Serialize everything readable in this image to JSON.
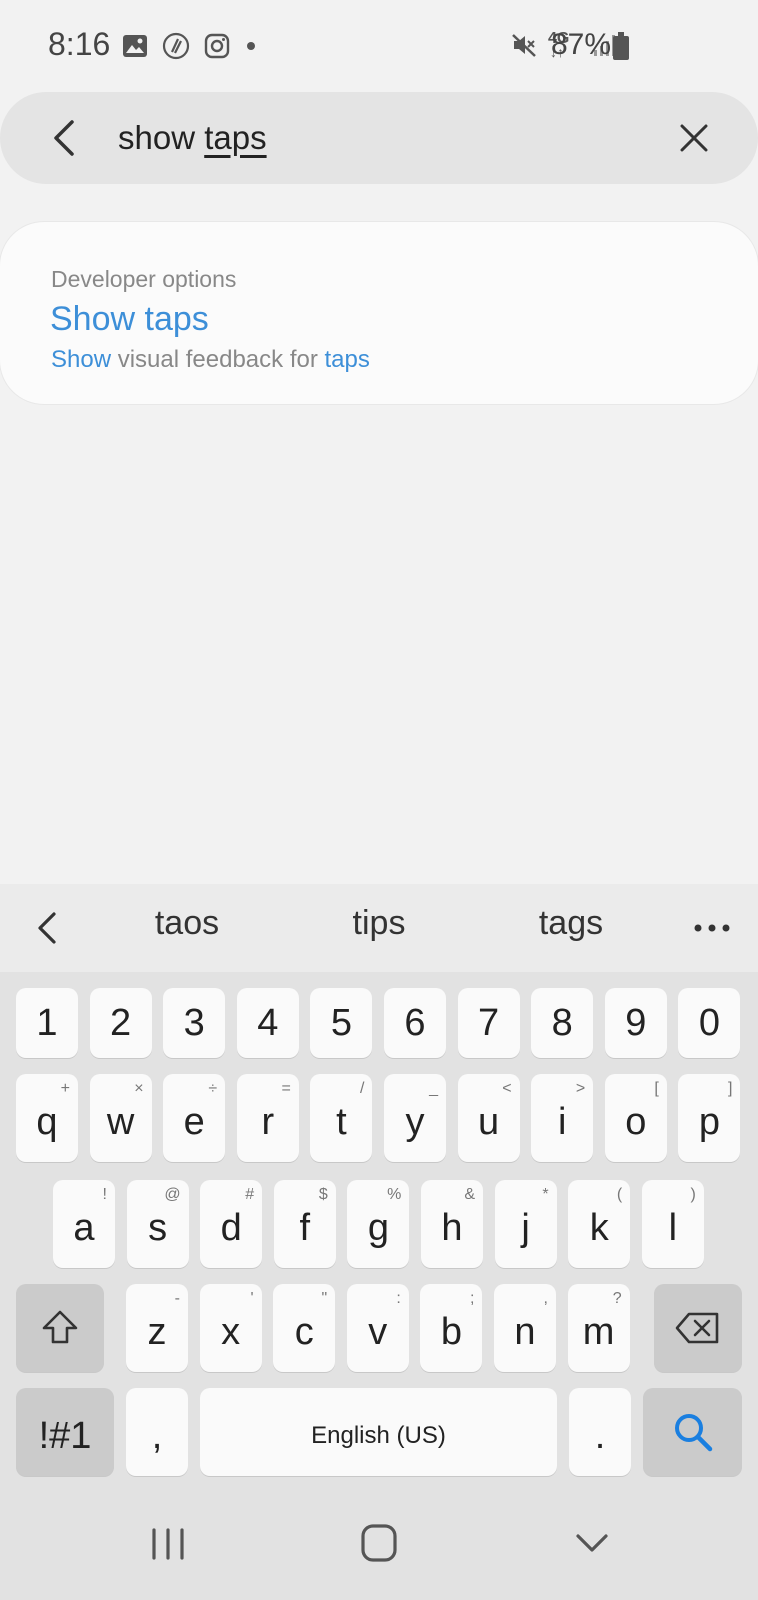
{
  "status_bar": {
    "time": "8:16",
    "network": "4G",
    "battery": "87%",
    "icons_left": [
      "gallery-icon",
      "vsco-icon",
      "instagram-icon",
      "notification-dot-icon"
    ],
    "icons_right": [
      "mute-icon",
      "lte-icon",
      "signal-icon",
      "battery-icon"
    ]
  },
  "search": {
    "query_prefix": "show ",
    "query_underlined": "taps"
  },
  "result": {
    "category": "Developer options",
    "title": "Show taps",
    "desc_1": "Show",
    "desc_2": " visual feedback for ",
    "desc_3": "taps"
  },
  "keyboard": {
    "suggestions": [
      "taos",
      "tips",
      "tags"
    ],
    "number_row": [
      "1",
      "2",
      "3",
      "4",
      "5",
      "6",
      "7",
      "8",
      "9",
      "0"
    ],
    "row1": [
      {
        "k": "q",
        "h": "+"
      },
      {
        "k": "w",
        "h": "×"
      },
      {
        "k": "e",
        "h": "÷"
      },
      {
        "k": "r",
        "h": "="
      },
      {
        "k": "t",
        "h": "/"
      },
      {
        "k": "y",
        "h": "_"
      },
      {
        "k": "u",
        "h": "<"
      },
      {
        "k": "i",
        "h": ">"
      },
      {
        "k": "o",
        "h": "["
      },
      {
        "k": "p",
        "h": "]"
      }
    ],
    "row2": [
      {
        "k": "a",
        "h": "!"
      },
      {
        "k": "s",
        "h": "@"
      },
      {
        "k": "d",
        "h": "#"
      },
      {
        "k": "f",
        "h": "$"
      },
      {
        "k": "g",
        "h": "%"
      },
      {
        "k": "h",
        "h": "&"
      },
      {
        "k": "j",
        "h": "*"
      },
      {
        "k": "k",
        "h": "("
      },
      {
        "k": "l",
        "h": ")"
      }
    ],
    "row3": [
      {
        "k": "z",
        "h": "-"
      },
      {
        "k": "x",
        "h": "'"
      },
      {
        "k": "c",
        "h": "\""
      },
      {
        "k": "v",
        "h": ":"
      },
      {
        "k": "b",
        "h": ";"
      },
      {
        "k": "n",
        "h": ","
      },
      {
        "k": "m",
        "h": "?"
      }
    ],
    "symbols_label": "!#1",
    "comma_label": ",",
    "space_label": "English (US)",
    "period_label": ".",
    "accent_color": "#1a7fe0"
  }
}
